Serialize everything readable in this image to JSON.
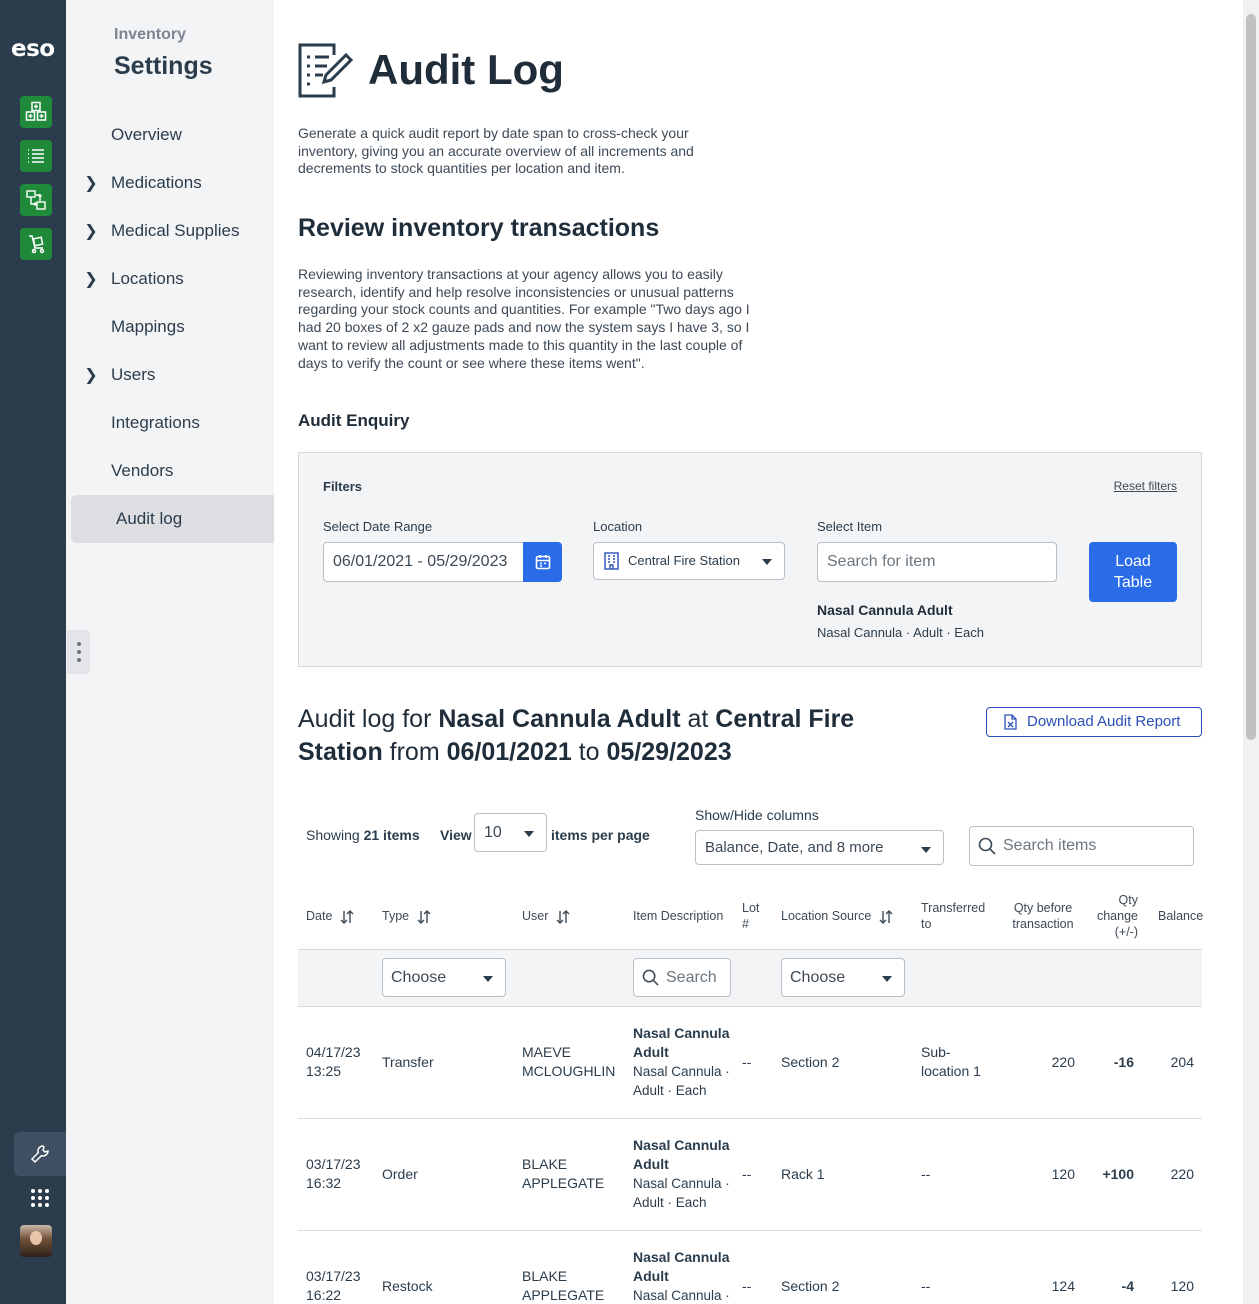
{
  "rail": {
    "logo": "eso",
    "apps": [
      "inventory-grid-icon",
      "list-icon",
      "transfer-icon",
      "cart-icon"
    ],
    "bottom": [
      "wrench-icon",
      "apps-grid-icon",
      "avatar"
    ]
  },
  "sidebar": {
    "supertitle": "Inventory",
    "title": "Settings",
    "items": [
      {
        "label": "Overview",
        "expandable": false
      },
      {
        "label": "Medications",
        "expandable": true
      },
      {
        "label": "Medical Supplies",
        "expandable": true
      },
      {
        "label": "Locations",
        "expandable": true
      },
      {
        "label": "Mappings",
        "expandable": false
      },
      {
        "label": "Users",
        "expandable": true
      },
      {
        "label": "Integrations",
        "expandable": false
      },
      {
        "label": "Vendors",
        "expandable": false
      },
      {
        "label": "Audit log",
        "expandable": false,
        "active": true
      }
    ]
  },
  "page": {
    "title": "Audit Log",
    "intro": "Generate a quick audit report by date span to cross-check your inventory, giving you an accurate overview of all increments and decrements to stock quantities per location and item.",
    "section_title": "Review inventory transactions",
    "section_text": "Reviewing inventory transactions at your agency allows you to easily research, identify and help resolve inconsistencies or unusual patterns regarding your stock counts and quantities. For example \"Two days ago I had 20 boxes of 2 x2 gauze pads and now the system says I have 3, so I want to review all adjustments made to this quantity in the last couple of days to verify the count or see where these items went\".",
    "enquiry_title": "Audit Enquiry"
  },
  "filters": {
    "title": "Filters",
    "reset": "Reset filters",
    "date_label": "Select Date Range",
    "date_value": "06/01/2021 - 05/29/2023",
    "location_label": "Location",
    "location_value": "Central Fire Station",
    "item_label": "Select Item",
    "item_placeholder": "Search for item",
    "load_line1": "Load",
    "load_line2": "Table",
    "selected_item_name": "Nasal Cannula Adult",
    "selected_item_desc": "Nasal Cannula · Adult · Each"
  },
  "log": {
    "prefix": "Audit log for ",
    "item": "Nasal Cannula Adult",
    "at": " at ",
    "location": "Central Fire Station",
    "from": " from ",
    "start": "06/01/2021",
    "to": " to ",
    "end": "05/29/2023",
    "download": "Download Audit Report"
  },
  "toolbar": {
    "showing_prefix": "Showing ",
    "showing_count": "21 items",
    "view_label": "View",
    "view_value": "10",
    "per_page": "items per page",
    "columns_label": "Show/Hide columns",
    "columns_value": "Balance, Date, and 8 more",
    "search_placeholder": "Search items"
  },
  "table": {
    "headers": {
      "date": "Date",
      "type": "Type",
      "user": "User",
      "item": "Item Description",
      "lot": "Lot #",
      "location": "Location Source",
      "transferred": "Transferred to",
      "qty_before": "Qty before transaction",
      "qty_change": "Qty change (+/-)",
      "balance": "Balance"
    },
    "filter_choose": "Choose",
    "filter_search": "Search",
    "rows": [
      {
        "date": "04/17/23",
        "time": "13:25",
        "type": "Transfer",
        "user1": "MAEVE",
        "user2": "MCLOUGHLIN",
        "item": "Nasal Cannula Adult",
        "item_sub": "Nasal Cannula · Adult · Each",
        "lot": "--",
        "location": "Section 2",
        "transferred": "Sub-location 1",
        "qty_before": "220",
        "qty_change": "-16",
        "balance": "204"
      },
      {
        "date": "03/17/23",
        "time": "16:32",
        "type": "Order",
        "user1": "BLAKE",
        "user2": "APPLEGATE",
        "item": "Nasal Cannula Adult",
        "item_sub": "Nasal Cannula · Adult · Each",
        "lot": "--",
        "location": "Rack 1",
        "transferred": "--",
        "qty_before": "120",
        "qty_change": "+100",
        "balance": "220"
      },
      {
        "date": "03/17/23",
        "time": "16:22",
        "type": "Restock",
        "user1": "BLAKE",
        "user2": "APPLEGATE",
        "item": "Nasal Cannula Adult",
        "item_sub": "Nasal Cannula · Adult · Each",
        "lot": "--",
        "location": "Section 2",
        "transferred": "--",
        "qty_before": "124",
        "qty_change": "-4",
        "balance": "120"
      }
    ]
  },
  "colors": {
    "rail": "#2b3d4c",
    "app_green": "#1f8a3a",
    "primary_blue": "#2a6be8",
    "sidebar_bg": "#f3f4f5"
  }
}
